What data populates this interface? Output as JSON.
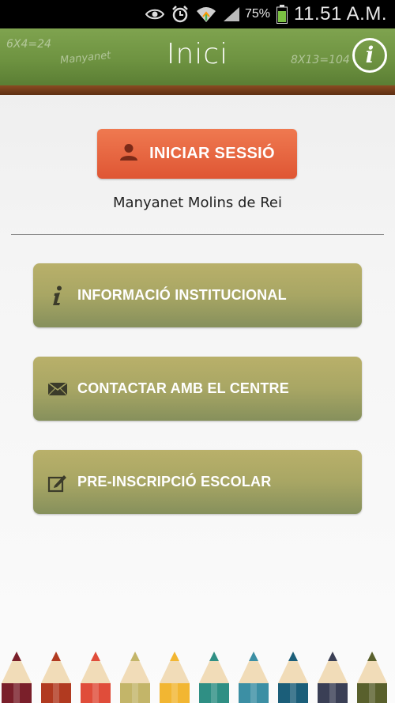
{
  "status_bar": {
    "battery_percent": "75%",
    "time": "11.51 A.M.",
    "icons": [
      "eye-icon",
      "alarm-icon",
      "wifi-icon",
      "signal-icon",
      "battery-icon"
    ]
  },
  "header": {
    "title": "Inici",
    "chalk_texts": [
      "6X4=24",
      "Manyanet",
      "8X13=104"
    ],
    "info_icon": "info-icon"
  },
  "login": {
    "label": "INICIAR SESSIÓ",
    "icon": "user-icon"
  },
  "school_name": "Manyanet Molins de Rei",
  "menu": {
    "items": [
      {
        "label": "INFORMACIÓ INSTITUCIONAL",
        "icon": "info-icon"
      },
      {
        "label": "CONTACTAR AMB EL CENTRE",
        "icon": "envelope-icon"
      },
      {
        "label": "PRE-INSCRIPCIÓ ESCOLAR",
        "icon": "edit-icon"
      }
    ]
  },
  "colors": {
    "header_green": "#6e9341",
    "login_orange": "#e5603a",
    "menu_olive": "#a8a664",
    "pencil_colors": [
      "#7a1f2a",
      "#b13a20",
      "#e04d3a",
      "#c3b569",
      "#f2b632",
      "#2f8f84",
      "#3c8fa4",
      "#1b5e79",
      "#3a3f55",
      "#59602c"
    ]
  }
}
